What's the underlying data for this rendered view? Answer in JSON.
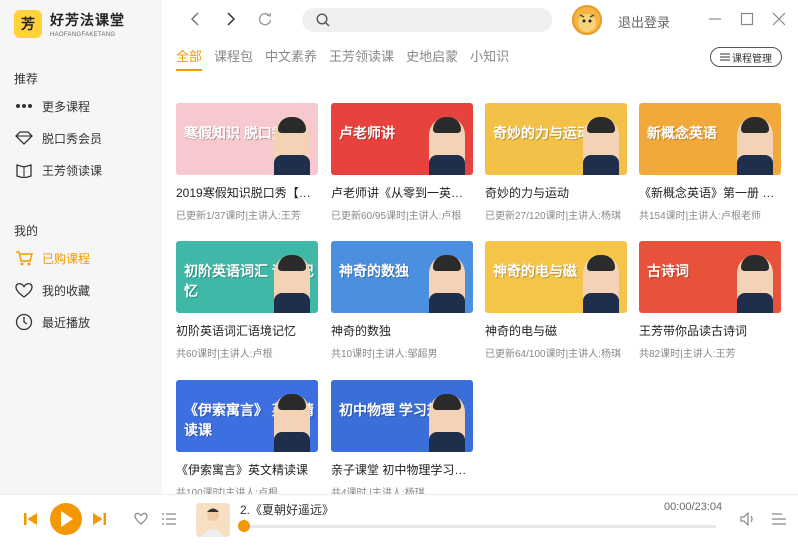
{
  "app": {
    "logo_char": "芳",
    "title": "好芳法课堂",
    "subtitle": "HAOFANGFAKETANG",
    "accent": "#f39800"
  },
  "sidebar": {
    "recommend_title": "推荐",
    "recommend_items": [
      {
        "label": "更多课程",
        "icon": "more-dots-icon"
      },
      {
        "label": "脱口秀会员",
        "icon": "diamond-icon"
      },
      {
        "label": "王芳领读课",
        "icon": "book-icon"
      }
    ],
    "mine_title": "我的",
    "mine_items": [
      {
        "label": "已购课程",
        "icon": "cart-icon",
        "active": true
      },
      {
        "label": "我的收藏",
        "icon": "heart-icon"
      },
      {
        "label": "最近播放",
        "icon": "clock-icon"
      }
    ]
  },
  "topbar": {
    "search_placeholder": "",
    "logout_label": "退出登录"
  },
  "tabs": [
    "全部",
    "课程包",
    "中文素养",
    "王芳领读课",
    "史地启蒙",
    "小知识"
  ],
  "active_tab": 0,
  "manage_label": "课程管理",
  "courses": [
    {
      "title": "2019寒假知识脱口秀【第…",
      "meta": "已更新1/37课时|主讲人:王芳",
      "thumb_text": "寒假知识 脱口秀",
      "bg": "#f7c9cf"
    },
    {
      "title": "卢老师讲《从零到一英语…",
      "meta": "已更新60/95课时|主讲人:卢根",
      "thumb_text": "卢老师讲",
      "bg": "#e8423f"
    },
    {
      "title": "奇妙的力与运动",
      "meta": "已更新27/120课时|主讲人:杨琪",
      "thumb_text": "奇妙的力与运动",
      "bg": "#f3c148"
    },
    {
      "title": "《新概念英语》第一册 全…",
      "meta": "共154课时|主讲人:卢根老师",
      "thumb_text": "新概念英语",
      "bg": "#f2a93b"
    },
    {
      "title": "初阶英语词汇语境记忆",
      "meta": "共60课时|主讲人:卢根",
      "thumb_text": "初阶英语词汇 语境记忆",
      "bg": "#3fb8a7"
    },
    {
      "title": "神奇的数独",
      "meta": "共10课时|主讲人:邹超男",
      "thumb_text": "神奇的数独",
      "bg": "#4a8fe0"
    },
    {
      "title": "神奇的电与磁",
      "meta": "已更新64/100课时|主讲人:杨琪",
      "thumb_text": "神奇的电与磁",
      "bg": "#f5c54a"
    },
    {
      "title": "王芳带你品读古诗词",
      "meta": "共82课时|主讲人:王芳",
      "thumb_text": "古诗词",
      "bg": "#e8523a"
    },
    {
      "title": "《伊索寓言》英文精读课",
      "meta": "共100课时|主讲人:卢根",
      "thumb_text": "《伊索寓言》 英文精读课",
      "bg": "#3d6fe0"
    },
    {
      "title": "亲子课堂 初中物理学习规划",
      "meta": "共4课时 |主讲人:杨琪",
      "thumb_text": "初中物理 学习规划",
      "bg": "#3a6ed8"
    }
  ],
  "player": {
    "track_title": "2.《夏朝好遥远》",
    "time": "00:00/23:04",
    "progress": 0.0
  }
}
